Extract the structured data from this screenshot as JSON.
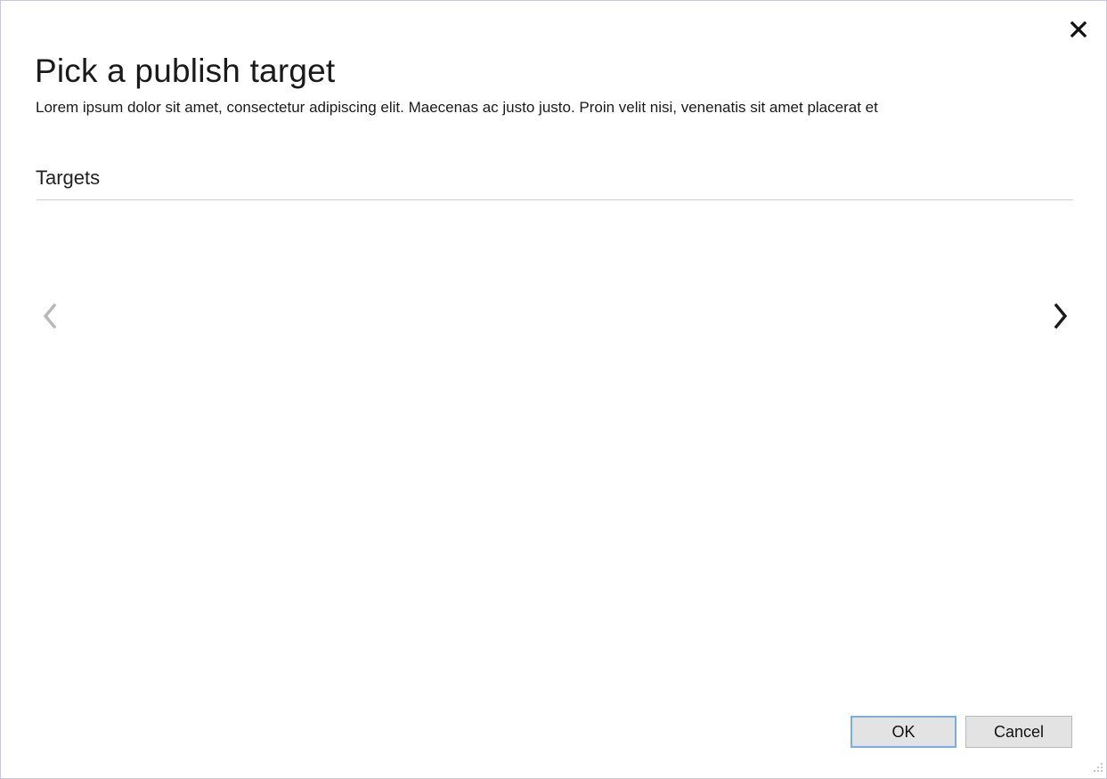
{
  "dialog": {
    "title": "Pick a publish target",
    "description": "Lorem ipsum dolor sit amet, consectetur adipiscing elit. Maecenas ac justo justo. Proin velit nisi, venenatis sit amet placerat et",
    "close_icon": "close-icon"
  },
  "targets": {
    "header": "Targets",
    "items": [],
    "prev_icon": "chevron-left-icon",
    "next_icon": "chevron-right-icon",
    "prev_enabled": false,
    "next_enabled": true
  },
  "footer": {
    "ok_label": "OK",
    "cancel_label": "Cancel"
  },
  "colors": {
    "ok_focus_border": "#7aaee0",
    "button_background": "#e3e3e3",
    "dialog_border": "#c9c6de",
    "disabled_arrow": "#b8b8b8",
    "enabled_arrow": "#1a1a1a"
  }
}
